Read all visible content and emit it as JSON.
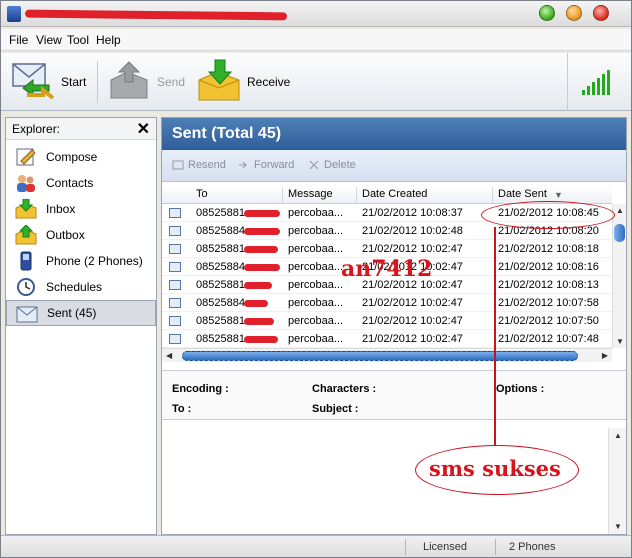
{
  "window": {
    "title": ""
  },
  "menu": {
    "file": "File",
    "view": "View",
    "tool": "Tool",
    "help": "Help"
  },
  "toolbar": {
    "start": "Start",
    "send": "Send",
    "receive": "Receive",
    "signal_bars": 6
  },
  "explorer": {
    "title": "Explorer:",
    "items": [
      {
        "label": "Compose",
        "icon": "compose-icon"
      },
      {
        "label": "Contacts",
        "icon": "contacts-icon"
      },
      {
        "label": "Inbox",
        "icon": "inbox-icon"
      },
      {
        "label": "Outbox",
        "icon": "outbox-icon"
      },
      {
        "label": "Phone   (2 Phones)",
        "icon": "phone-icon"
      },
      {
        "label": "Schedules",
        "icon": "clock-icon"
      },
      {
        "label": "Sent   (45)",
        "icon": "sent-icon"
      }
    ]
  },
  "main": {
    "title": "Sent (Total 45)",
    "actions": {
      "resend": "Resend",
      "forward": "Forward",
      "delete": "Delete"
    },
    "columns": {
      "to": "To",
      "message": "Message",
      "created": "Date Created",
      "sent": "Date Sent"
    },
    "rows": [
      {
        "to": "08525881",
        "message": "percobaa...",
        "created": "21/02/2012 10:08:37",
        "sent": "21/02/2012 10:08:45"
      },
      {
        "to": "08525884",
        "message": "percobaa...",
        "created": "21/02/2012 10:02:48",
        "sent": "21/02/2012 10:08:20"
      },
      {
        "to": "08525881",
        "message": "percobaa...",
        "created": "21/02/2012 10:02:47",
        "sent": "21/02/2012 10:08:18"
      },
      {
        "to": "08525884",
        "message": "percobaa...",
        "created": "21/02/2012 10:02:47",
        "sent": "21/02/2012 10:08:16"
      },
      {
        "to": "08525881",
        "message": "percobaa...",
        "created": "21/02/2012 10:02:47",
        "sent": "21/02/2012 10:08:13"
      },
      {
        "to": "08525884",
        "message": "percobaa...",
        "created": "21/02/2012 10:02:47",
        "sent": "21/02/2012 10:07:58"
      },
      {
        "to": "08525881",
        "message": "percobaa...",
        "created": "21/02/2012 10:02:47",
        "sent": "21/02/2012 10:07:50"
      },
      {
        "to": "08525881",
        "message": "percobaa...",
        "created": "21/02/2012 10:02:47",
        "sent": "21/02/2012 10:07:48"
      }
    ],
    "details": {
      "encoding": "Encoding :",
      "characters": "Characters :",
      "options": "Options :",
      "to": "To :",
      "subject": "Subject :"
    }
  },
  "annotations": {
    "watermark": "an7412",
    "callout": "sms sukses"
  },
  "status": {
    "license": "Licensed",
    "phones": "2 Phones"
  },
  "colors": {
    "header_blue": "#2e5d99",
    "annotation_red": "#d7141e",
    "signal_green": "#23a820"
  }
}
